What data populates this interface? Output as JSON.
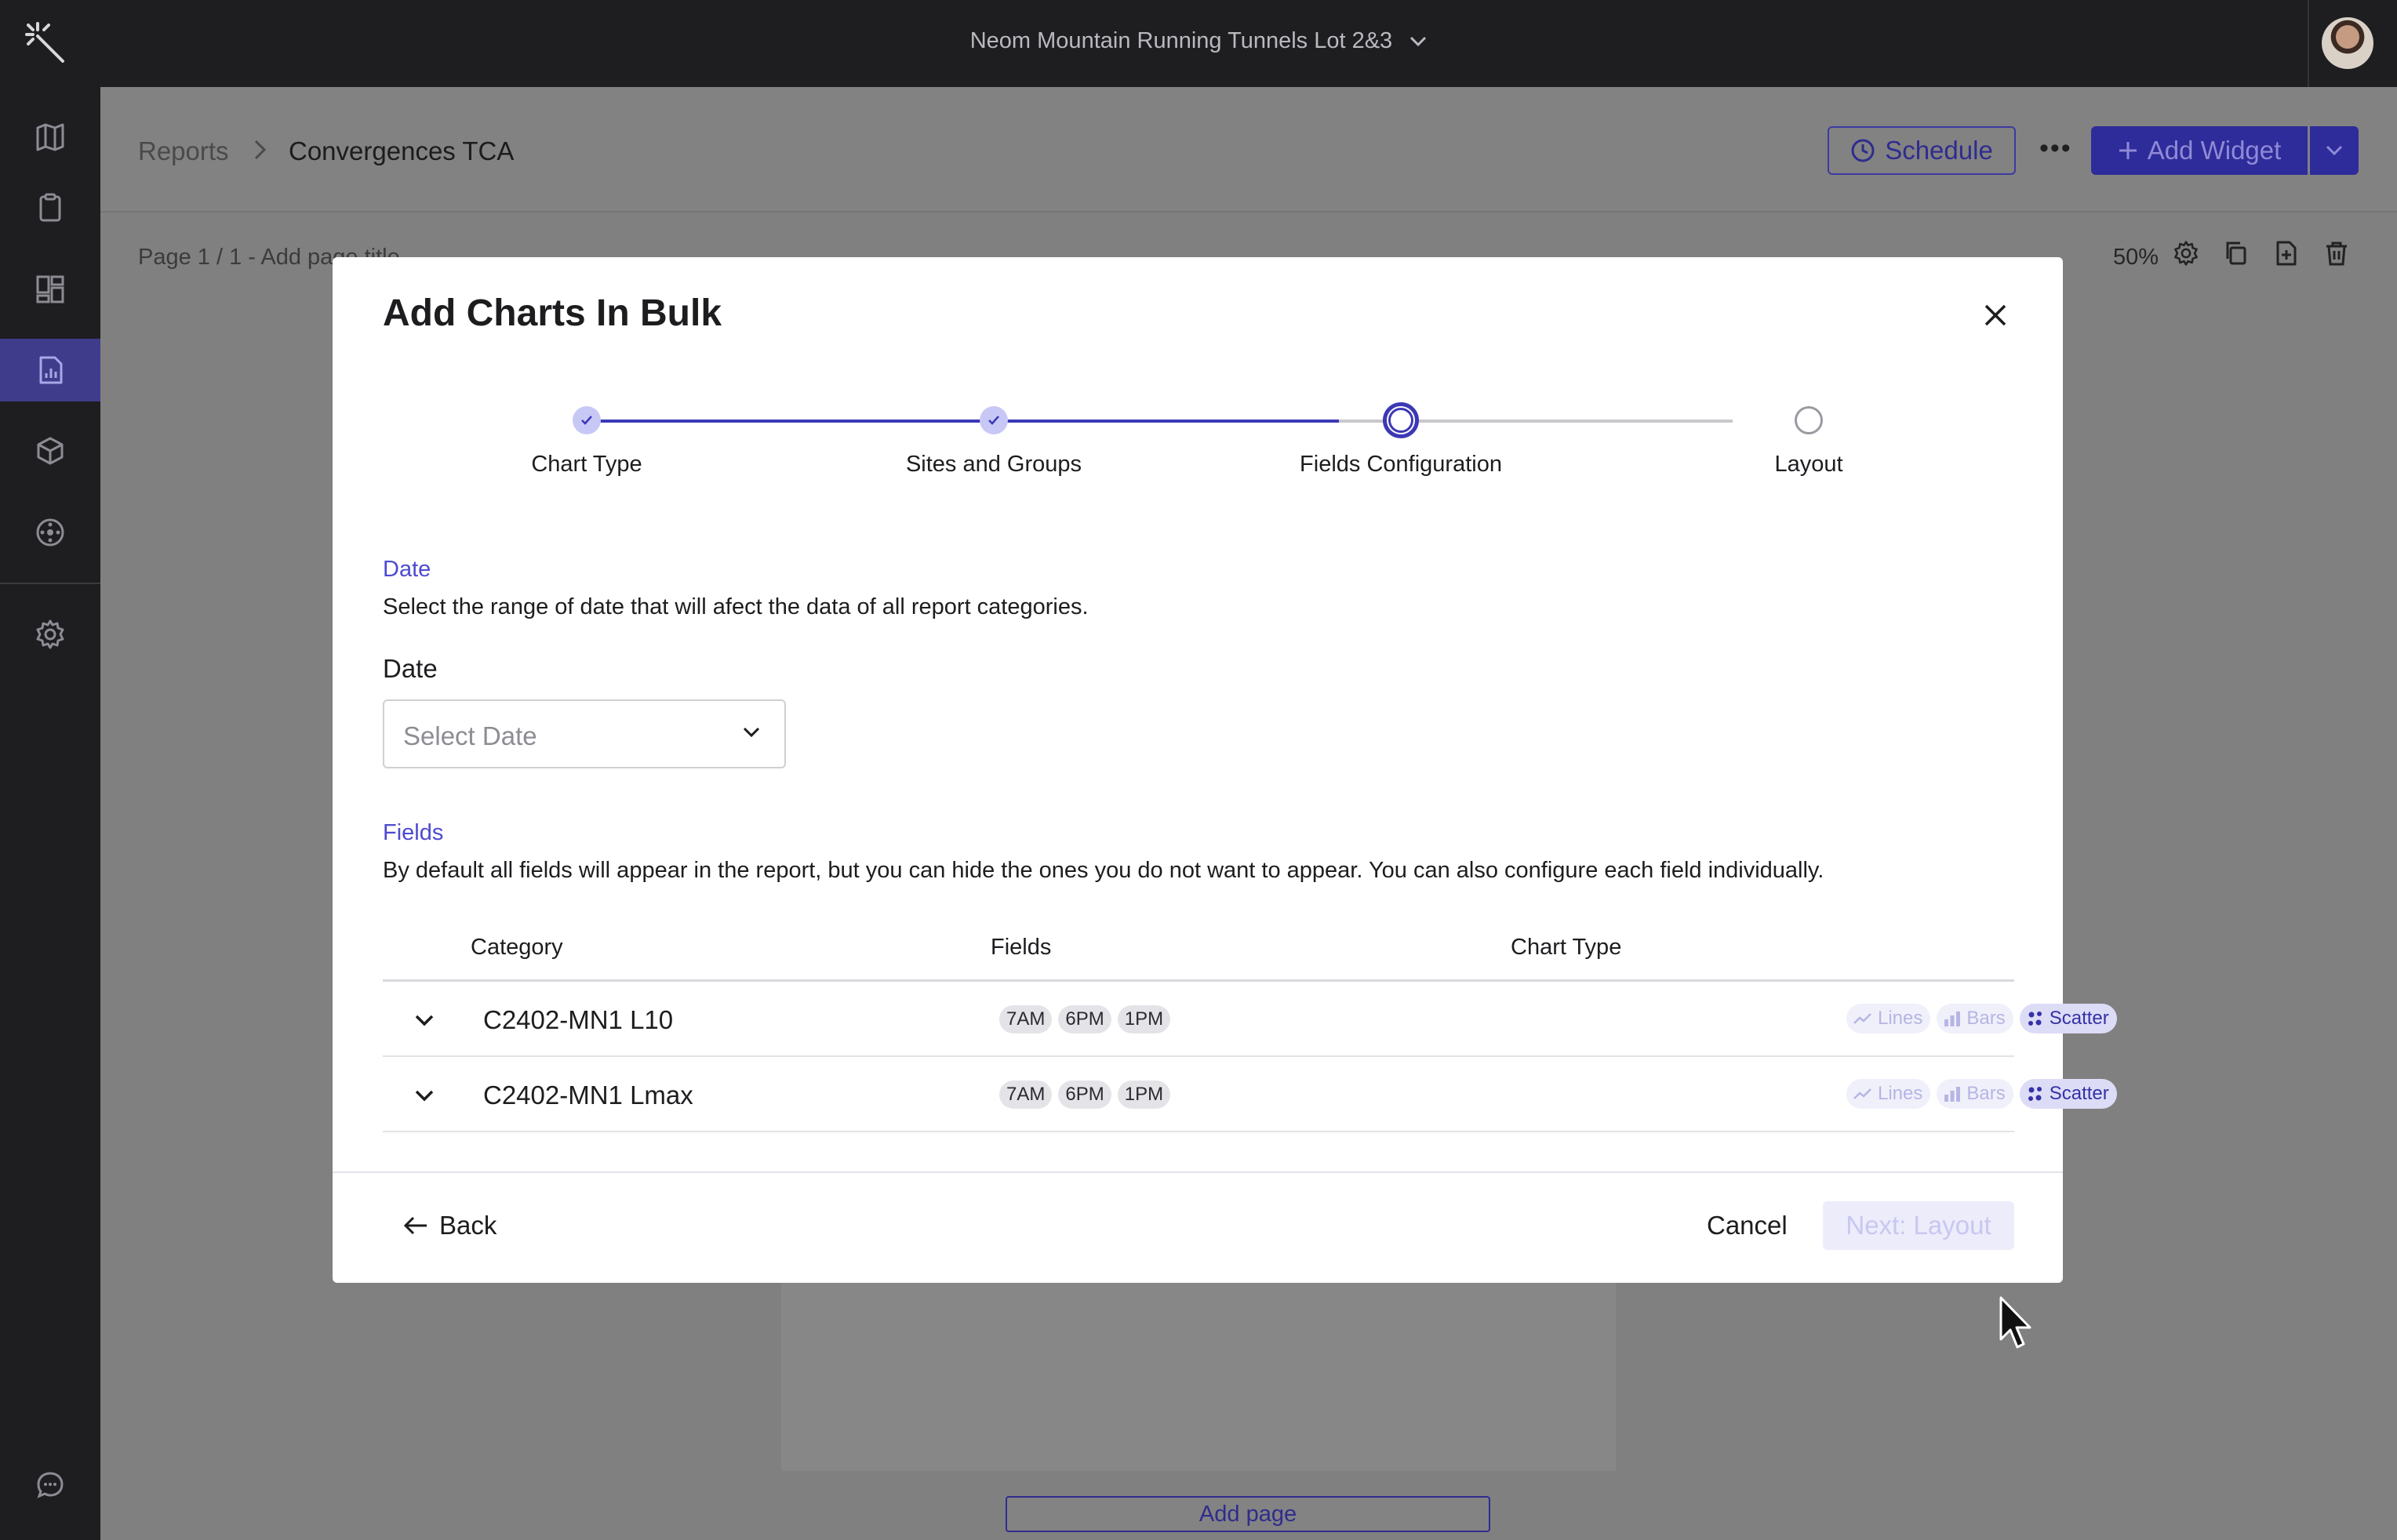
{
  "topbar": {
    "project_name": "Neom Mountain Running Tunnels Lot 2&3"
  },
  "sidebar": {
    "items": [
      {
        "icon": "map-icon"
      },
      {
        "icon": "clipboard-icon"
      },
      {
        "icon": "dashboard-icon"
      },
      {
        "icon": "report-icon",
        "active": true
      },
      {
        "icon": "cube-icon"
      },
      {
        "icon": "target-icon"
      },
      {
        "icon": "gear-icon"
      },
      {
        "icon": "chat-icon"
      }
    ]
  },
  "header": {
    "breadcrumb_root": "Reports",
    "breadcrumb_current": "Convergences TCA",
    "schedule_label": "Schedule",
    "add_widget_label": "Add Widget",
    "page_title": "Page 1 / 1 - Add page title",
    "zoom": "50%"
  },
  "canvas": {
    "add_page_label": "Add page"
  },
  "modal": {
    "title": "Add Charts In Bulk",
    "steps": [
      {
        "label": "Chart Type",
        "state": "done"
      },
      {
        "label": "Sites and Groups",
        "state": "done"
      },
      {
        "label": "Fields Configuration",
        "state": "current"
      },
      {
        "label": "Layout",
        "state": "todo"
      }
    ],
    "date_section": {
      "label": "Date",
      "description": "Select the range of date that will afect the data of all report categories.",
      "field_label": "Date",
      "placeholder": "Select Date"
    },
    "fields_section": {
      "label": "Fields",
      "description": "By default all fields will appear in the report, but you can hide the ones you do not want to appear. You can also configure each field individually."
    },
    "table": {
      "columns": [
        "Category",
        "Fields",
        "Chart Type"
      ],
      "rows": [
        {
          "category": "C2402-MN1 L10",
          "fields": [
            "7AM",
            "6PM",
            "1PM"
          ],
          "chart_types": [
            "Lines",
            "Bars",
            "Scatter"
          ],
          "selected_type": "Scatter"
        },
        {
          "category": "C2402-MN1 Lmax",
          "fields": [
            "7AM",
            "6PM",
            "1PM"
          ],
          "chart_types": [
            "Lines",
            "Bars",
            "Scatter"
          ],
          "selected_type": "Scatter"
        }
      ]
    },
    "footer": {
      "back_label": "Back",
      "cancel_label": "Cancel",
      "next_label": "Next: Layout"
    }
  },
  "colors": {
    "accent": "#3c38b5",
    "topbar_bg": "#1e1e21",
    "overlay_bg": "#808080"
  }
}
